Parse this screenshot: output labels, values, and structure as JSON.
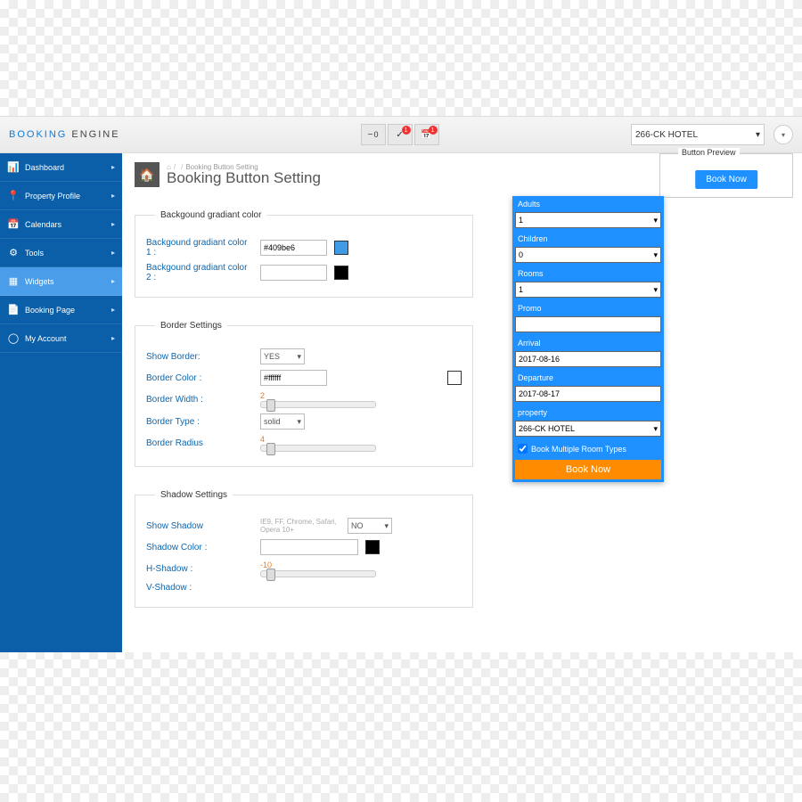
{
  "brand": {
    "part1": "BOOKING",
    "part2": " ENGINE"
  },
  "topbar": {
    "btns": [
      {
        "icon": "−",
        "badge": "0"
      },
      {
        "icon": "✓",
        "badge": "1"
      },
      {
        "icon": "📅",
        "badge": "1"
      }
    ],
    "property_selected": "266-CK HOTEL"
  },
  "sidebar": {
    "items": [
      {
        "icon": "📊",
        "label": "Dashboard"
      },
      {
        "icon": "📍",
        "label": "Property Profile"
      },
      {
        "icon": "📅",
        "label": "Calendars"
      },
      {
        "icon": "⚙",
        "label": "Tools"
      },
      {
        "icon": "▦",
        "label": "Widgets",
        "active": true
      },
      {
        "icon": "📄",
        "label": "Booking Page"
      },
      {
        "icon": "◯",
        "label": "My Account"
      }
    ]
  },
  "breadcrumbs": {
    "home": "🏠",
    "current": "Booking Button Setting"
  },
  "page_title": "Booking Button Setting",
  "preview": {
    "legend": "Button Preview",
    "button": "Book Now"
  },
  "sections": {
    "gradient": {
      "legend": "Backgound gradiant color",
      "c1_label": "Backgound gradiant color 1 :",
      "c1_value": "#409be6",
      "c2_label": "Backgound gradiant color 2 :",
      "c2_value": ""
    },
    "border": {
      "legend": "Border Settings",
      "show_label": "Show Border:",
      "show_value": "YES",
      "color_label": "Border Color :",
      "color_value": "#ffffff",
      "width_label": "Border Width :",
      "width_value": "2",
      "type_label": "Border Type :",
      "type_value": "solid",
      "radius_label": "Border Radius",
      "radius_value": "4"
    },
    "shadow": {
      "legend": "Shadow Settings",
      "show_label": "Show Shadow",
      "show_note": "IE9, FF, Chrome, Safari, Opera 10+",
      "show_value": "NO",
      "color_label": "Shadow Color :",
      "color_value": "",
      "h_label": "H-Shadow :",
      "h_value": "-10",
      "v_label": "V-Shadow :"
    }
  },
  "widget": {
    "adults_label": "Adults",
    "adults": "1",
    "children_label": "Children",
    "children": "0",
    "rooms_label": "Rooms",
    "rooms": "1",
    "promo_label": "Promo",
    "promo": "",
    "arrival_label": "Arrival",
    "arrival": "2017-08-16",
    "departure_label": "Departure",
    "departure": "2017-08-17",
    "property_label": "property",
    "property": "266-CK HOTEL",
    "multi": "Book Multiple Room Types",
    "book": "Book Now"
  }
}
